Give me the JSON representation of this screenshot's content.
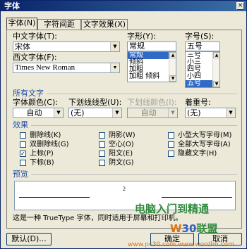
{
  "window": {
    "title": "字体",
    "close_glyph": "×"
  },
  "tabs": [
    {
      "label": "字体(N)",
      "active": true
    },
    {
      "label": "字符间距(R)",
      "active": false
    },
    {
      "label": "文字效果(X)",
      "active": false
    }
  ],
  "font": {
    "chinese_label": "中文字体(T):",
    "chinese_value": "宋体",
    "western_label": "西文字体(F):",
    "western_value": "Times New Roman",
    "style_label": "字形(Y):",
    "style_value": "常规",
    "style_options": [
      "常规",
      "倾斜",
      "加粗",
      "加粗 倾斜"
    ],
    "style_selected_index": 0,
    "size_label": "字号(S):",
    "size_value": "五号",
    "size_options": [
      "三号",
      "小三",
      "四号",
      "小四",
      "五号"
    ],
    "size_selected_index": 4
  },
  "all_text": {
    "section_label": "所有文字",
    "color_label": "字体颜色(C):",
    "color_value": "自动",
    "underline_label": "下划线线型(U):",
    "underline_value": "(无)",
    "underline_color_label": "下划线颜色(I):",
    "underline_color_value": "自动",
    "emphasis_label": "着重号:",
    "emphasis_value": "(无)"
  },
  "effects": {
    "section_label": "效果",
    "items": [
      {
        "label": "删除线(K)",
        "checked": false
      },
      {
        "label": "双删除线(G)",
        "checked": false
      },
      {
        "label": "上标(P)",
        "checked": true
      },
      {
        "label": "下标(B)",
        "checked": false
      },
      {
        "label": "阴影(W)",
        "checked": false
      },
      {
        "label": "空心(O)",
        "checked": false
      },
      {
        "label": "阳文(E)",
        "checked": false
      },
      {
        "label": "阴文(G)",
        "checked": false
      },
      {
        "label": "小型大写字母(M)",
        "checked": false
      },
      {
        "label": "全部大写字母(A)",
        "checked": false
      },
      {
        "label": "隐藏文字(H)",
        "checked": false
      }
    ],
    "check_glyph": "✓"
  },
  "preview": {
    "section_label": "预览",
    "sample_text": "2",
    "note": "这是一种 TrueType 字体，同时适用于屏幕和打印机。"
  },
  "buttons": {
    "default_label": "默认(D)...",
    "ok_label": "确定",
    "cancel_label": "取消"
  },
  "watermark": {
    "line1": "电脑入门到精通",
    "line2_a": "W",
    "line2_b": "30",
    "line2_c": "联盟",
    "line3": "www.pc30.com  www.wordlm.com"
  },
  "colors": {
    "titlebar": "#0a246a",
    "selection": "#316ac5",
    "section_label": "#1f4ba0"
  }
}
